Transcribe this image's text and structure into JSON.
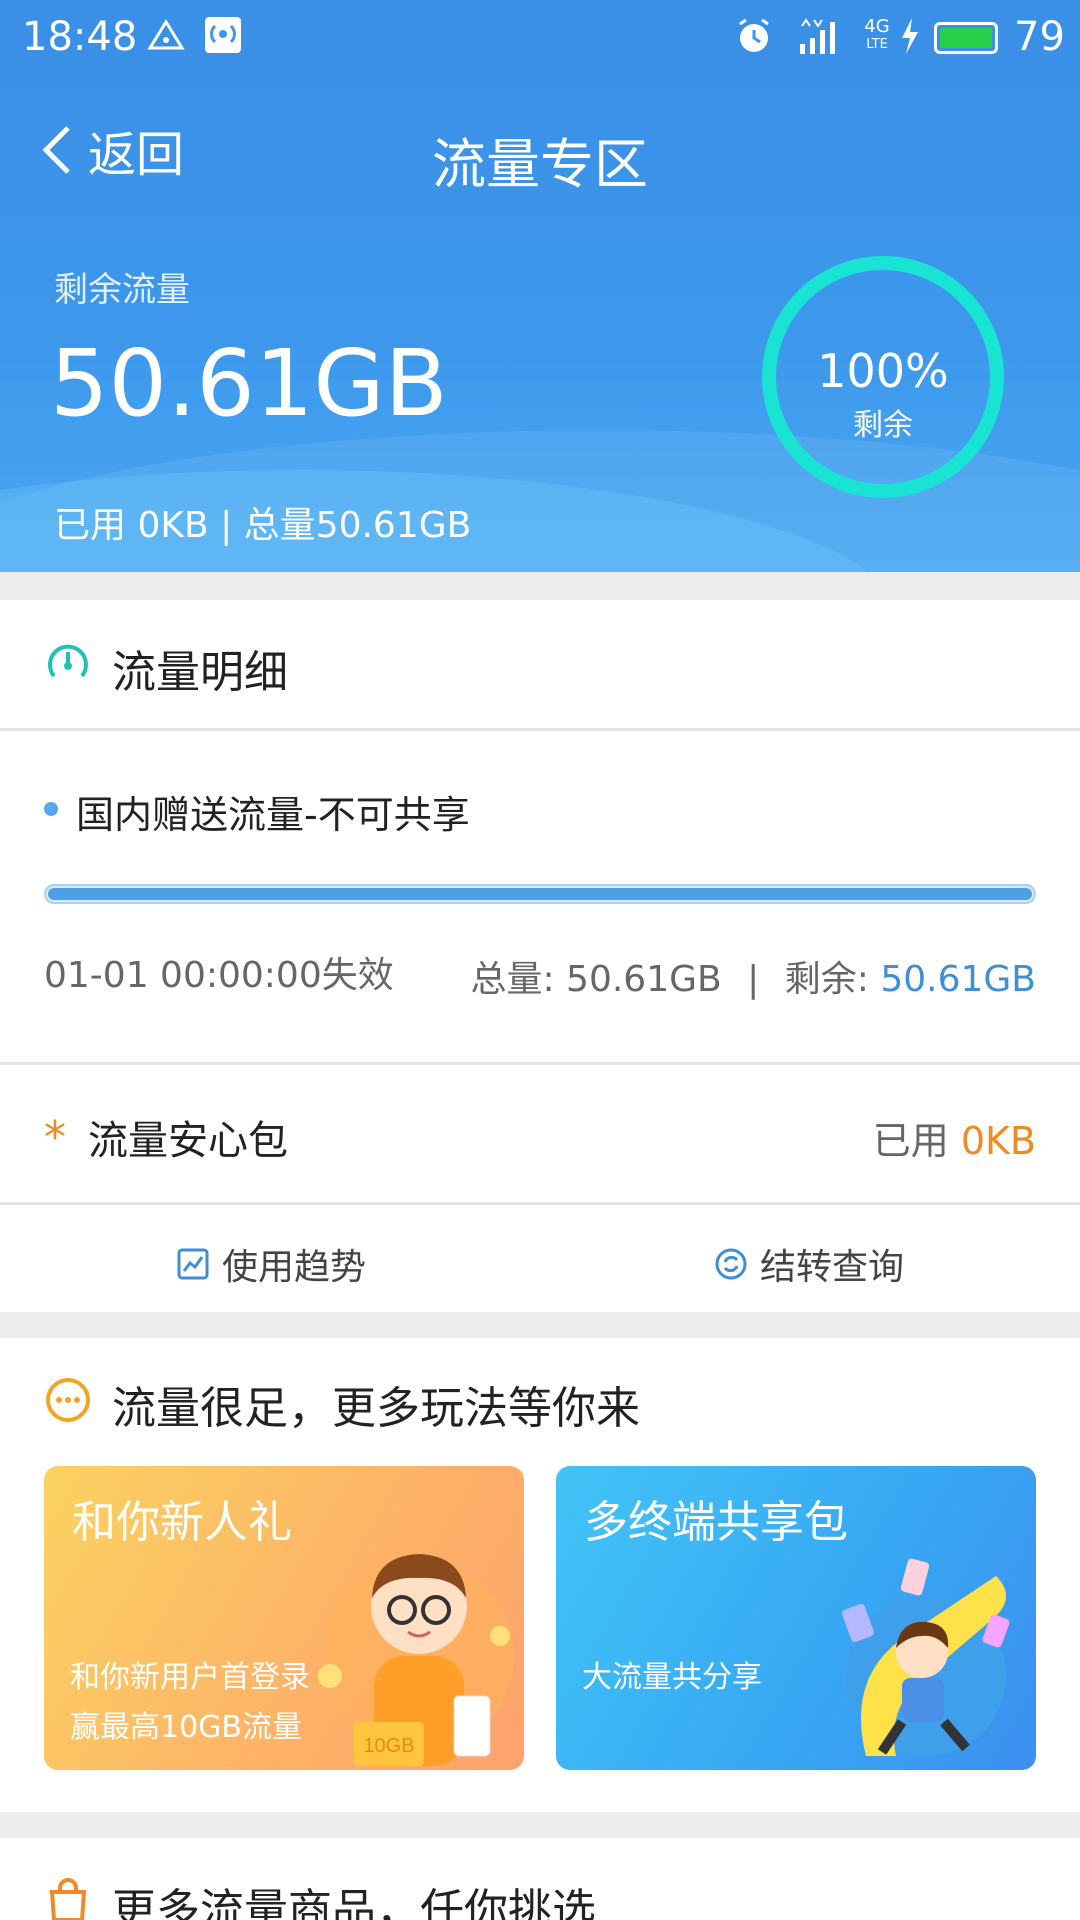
{
  "status_bar": {
    "time": "18:48",
    "network": "4G",
    "network_sub": "LTE",
    "battery": "79"
  },
  "nav": {
    "back_label": "返回",
    "title": "流量专区"
  },
  "summary": {
    "remaining_label": "剩余流量",
    "remaining_value": "50.61GB",
    "used_line": "已用 0KB | 总量50.61GB",
    "ring_percent": "100%",
    "ring_label": "剩余",
    "ring_color": "#19e3d2"
  },
  "detail": {
    "section_title": "流量明细",
    "item_name": "国内赠送流量-不可共享",
    "progress_remaining_fraction": 1.0,
    "expire": "01-01 00:00:00失效",
    "total_label": "总量:",
    "total_value": "50.61GB",
    "remain_label": "剩余:",
    "remain_value": "50.61GB"
  },
  "anxin": {
    "star": "*",
    "name": "流量安心包",
    "used_label": "已用",
    "used_value": "0KB"
  },
  "actions": {
    "trend": "使用趋势",
    "carryover": "结转查询"
  },
  "promo_section": {
    "title": "流量很足，更多玩法等你来",
    "cards": [
      {
        "title": "和你新人礼",
        "line1": "和你新用户首登录",
        "line2": "赢最高10GB流量",
        "badge": "10GB"
      },
      {
        "title": "多终端共享包",
        "line1": "大流量共分享"
      }
    ]
  },
  "more_section": {
    "title": "更多流量商品，任你挑选"
  },
  "colors": {
    "header_blue": "#3d98ec",
    "accent_blue": "#3e8ed8",
    "accent_orange": "#f08a24",
    "teal": "#19e3d2"
  }
}
